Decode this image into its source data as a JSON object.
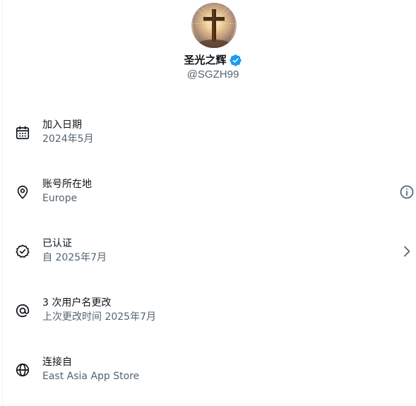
{
  "profile": {
    "display_name": "圣光之辉",
    "handle": "@SGZH99",
    "verified_icon": "verified-badge-icon",
    "avatar_icon": "cross-avatar"
  },
  "rows": [
    {
      "title": "加入日期",
      "subtitle": "2024年5月",
      "icon": "calendar-icon"
    },
    {
      "title": "账号所在地",
      "subtitle": "Europe",
      "icon": "location-pin-icon",
      "action_icon": "info-icon"
    },
    {
      "title": "已认证",
      "subtitle": "自 2025年7月",
      "icon": "verified-outline-icon",
      "action_icon": "chevron-right-icon"
    },
    {
      "title": "3 次用户名更改",
      "subtitle": "上次更改时间 2025年7月",
      "icon": "at-icon"
    },
    {
      "title": "连接自",
      "subtitle": "East Asia App Store",
      "icon": "globe-icon"
    }
  ],
  "colors": {
    "primary_text": "#0f1419",
    "secondary_text": "#536471",
    "verified_blue": "#1d9bf0",
    "border": "#eff3f4"
  }
}
